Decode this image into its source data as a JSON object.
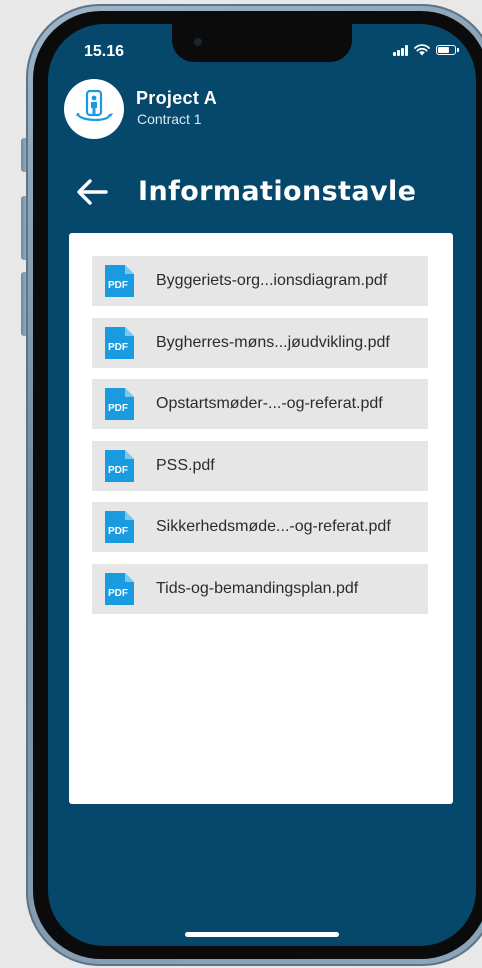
{
  "status_bar": {
    "time": "15.16",
    "battery_level": 0.75
  },
  "header": {
    "project_name": "Project A",
    "contract": "Contract 1",
    "logo_icon": "person-rotation-icon"
  },
  "page": {
    "title": "Informationstavle",
    "back_icon": "arrow-left-icon"
  },
  "files": [
    {
      "icon_label": "PDF",
      "name": "Byggeriets-org...ionsdiagram.pdf"
    },
    {
      "icon_label": "PDF",
      "name": "Bygherres-møns...jøudvikling.pdf"
    },
    {
      "icon_label": "PDF",
      "name": "Opstartsmøder-...-og-referat.pdf"
    },
    {
      "icon_label": "PDF",
      "name": "PSS.pdf"
    },
    {
      "icon_label": "PDF",
      "name": "Sikkerhedsmøde...-og-referat.pdf"
    },
    {
      "icon_label": "PDF",
      "name": "Tids-og-bemandingsplan.pdf"
    }
  ],
  "colors": {
    "screen_background": "#06486b",
    "pdf_icon": "#1a9be0",
    "list_item_background": "#e6e6e6"
  }
}
